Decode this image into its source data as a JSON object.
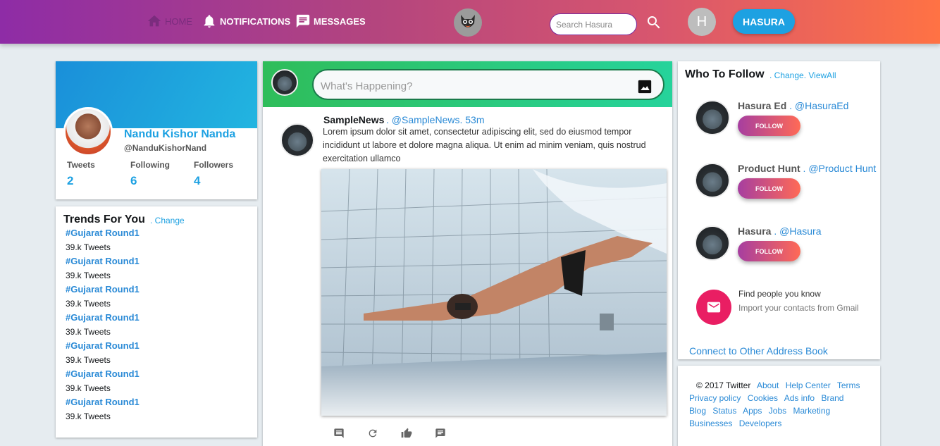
{
  "nav": {
    "home": "HOME",
    "notifications": "NOTIFICATIONS",
    "messages": "MESSAGES",
    "search_placeholder": "Search Hasura",
    "avatar_letter": "H",
    "user_button": "HASURA"
  },
  "profile": {
    "name": "Nandu Kishor Nanda",
    "handle": "@NanduKishorNand",
    "stats": [
      {
        "label": "Tweets",
        "value": "2"
      },
      {
        "label": "Following",
        "value": "6"
      },
      {
        "label": "Followers",
        "value": "4"
      }
    ]
  },
  "trends": {
    "title": "Trends For You",
    "change": ". Change",
    "items": [
      {
        "tag": "#Gujarat Round1",
        "count": "39.k Tweets"
      },
      {
        "tag": "#Gujarat Round1",
        "count": "39.k Tweets"
      },
      {
        "tag": "#Gujarat Round1",
        "count": "39.k Tweets"
      },
      {
        "tag": "#Gujarat Round1",
        "count": "39.k Tweets"
      },
      {
        "tag": "#Gujarat Round1",
        "count": "39.k Tweets"
      },
      {
        "tag": "#Gujarat Round1",
        "count": "39.k Tweets"
      },
      {
        "tag": "#Gujarat Round1",
        "count": "39.k Tweets"
      }
    ]
  },
  "composer": {
    "placeholder": "What's Happening?"
  },
  "tweet": {
    "name": "SampleNews",
    "handle": ". @SampleNews. 53m",
    "body": "Lorem ipsum dolor sit amet, consectetur adipiscing elit, sed do eiusmod tempor incididunt ut labore et dolore magna aliqua. Ut enim ad minim veniam, quis nostrud exercitation ullamco"
  },
  "who_to_follow": {
    "title": "Who To Follow",
    "links": ". Change. ViewAll",
    "suggestions": [
      {
        "name": "Hasura Ed",
        "handle": " . @HasuraEd",
        "button": "FOLLOW"
      },
      {
        "name": "Product Hunt",
        "handle": " . @Product Hunt",
        "button": "FOLLOW"
      },
      {
        "name": "Hasura",
        "handle": " . @Hasura",
        "button": "FOLLOW"
      }
    ],
    "find_title": "Find people you know",
    "find_sub": "Import your contacts from Gmail",
    "connect": "Connect to Other Address Book"
  },
  "footer": {
    "copyright": "© 2017 Twitter",
    "links": [
      "About",
      "Help Center",
      "Terms",
      "Privacy policy",
      "Cookies",
      "Ads info",
      "Brand",
      "Blog",
      "Status",
      "Apps",
      "Jobs",
      "Marketing",
      "Businesses",
      "Developers"
    ]
  },
  "colors": {
    "accent": "#1da1e2",
    "header_start": "#8e2ca6",
    "header_end": "#ff7244",
    "composer": "#26d39b",
    "mail": "#e91e63"
  }
}
